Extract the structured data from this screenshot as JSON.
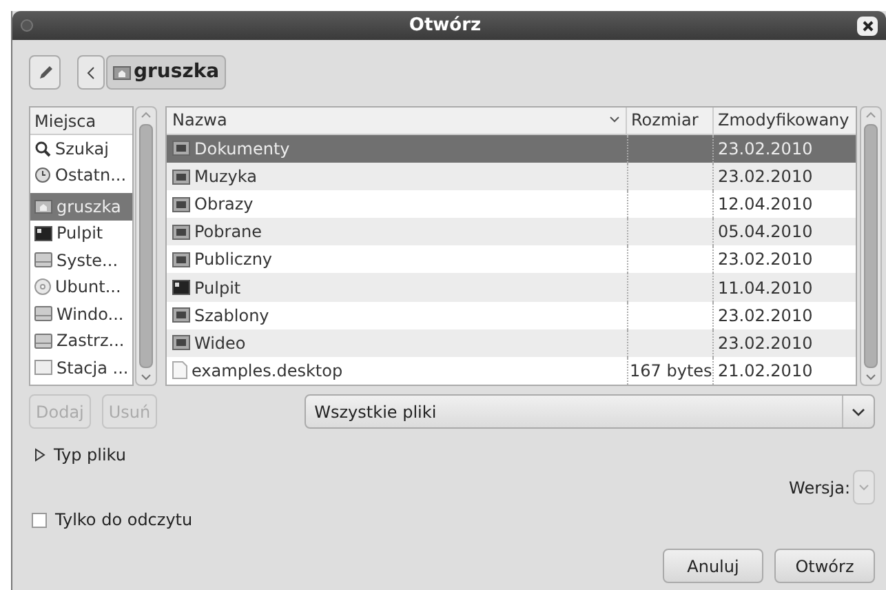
{
  "window": {
    "title": "Otwórz"
  },
  "path_bar": {
    "current": "gruszka"
  },
  "places": {
    "header": "Miejsca",
    "items": [
      {
        "label": "Szukaj",
        "kind": "search",
        "selected": false
      },
      {
        "label": "Ostatn...",
        "kind": "recent",
        "selected": false
      },
      {
        "label": "gruszka",
        "kind": "home",
        "selected": true
      },
      {
        "label": "Pulpit",
        "kind": "desktop",
        "selected": false
      },
      {
        "label": "Syste...",
        "kind": "drive",
        "selected": false
      },
      {
        "label": "Ubunt...",
        "kind": "disc",
        "selected": false
      },
      {
        "label": "Windo...",
        "kind": "drive",
        "selected": false
      },
      {
        "label": "Zastrz...",
        "kind": "drive",
        "selected": false
      },
      {
        "label": "Stacja ...",
        "kind": "blank",
        "selected": false
      }
    ]
  },
  "places_buttons": [
    {
      "label": "Dodaj",
      "disabled": true
    },
    {
      "label": "Usuń",
      "disabled": true
    }
  ],
  "table": {
    "columns": [
      "Nazwa",
      "Rozmiar",
      "Zmodyfikowany"
    ],
    "rows": [
      {
        "name": "Dokumenty",
        "size": "",
        "modified": "23.02.2010",
        "kind": "folder",
        "selected": true
      },
      {
        "name": "Muzyka",
        "size": "",
        "modified": "23.02.2010",
        "kind": "folder",
        "selected": false
      },
      {
        "name": "Obrazy",
        "size": "",
        "modified": "12.04.2010",
        "kind": "folder",
        "selected": false
      },
      {
        "name": "Pobrane",
        "size": "",
        "modified": "05.04.2010",
        "kind": "folder",
        "selected": false
      },
      {
        "name": "Publiczny",
        "size": "",
        "modified": "23.02.2010",
        "kind": "folder",
        "selected": false
      },
      {
        "name": "Pulpit",
        "size": "",
        "modified": "11.04.2010",
        "kind": "desktop",
        "selected": false
      },
      {
        "name": "Szablony",
        "size": "",
        "modified": "23.02.2010",
        "kind": "folder",
        "selected": false
      },
      {
        "name": "Wideo",
        "size": "",
        "modified": "23.02.2010",
        "kind": "folder",
        "selected": false
      },
      {
        "name": "examples.desktop",
        "size": "167 bytes",
        "modified": "21.02.2010",
        "kind": "file",
        "selected": false
      }
    ]
  },
  "filter": {
    "value": "Wszystkie pliki"
  },
  "file_type": {
    "label": "Typ pliku",
    "expanded": false
  },
  "version": {
    "label": "Wersja:"
  },
  "read_only": {
    "label": "Tylko do odczytu",
    "checked": false
  },
  "buttons": [
    "Anuluj",
    "Otwórz"
  ]
}
